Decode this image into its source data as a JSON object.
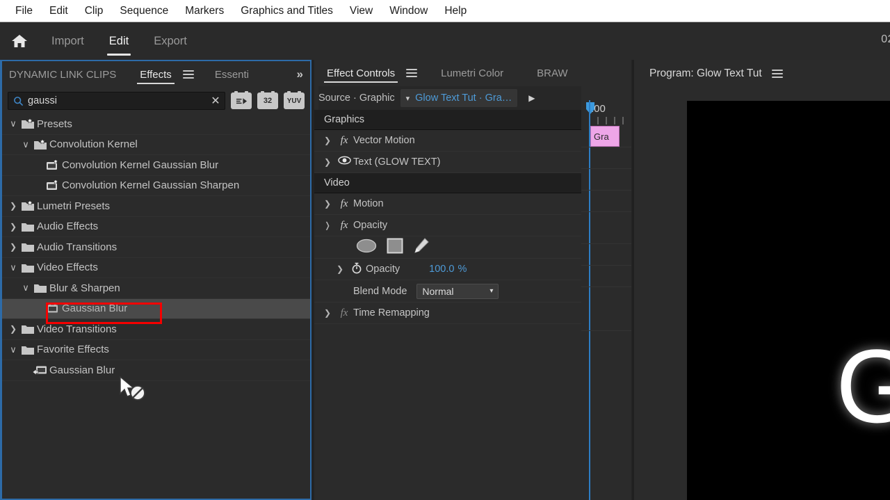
{
  "menubar": {
    "items": [
      "File",
      "Edit",
      "Clip",
      "Sequence",
      "Markers",
      "Graphics and Titles",
      "View",
      "Window",
      "Help"
    ]
  },
  "workspace": {
    "home_icon": "home-icon",
    "tabs": [
      {
        "label": "Import",
        "active": false
      },
      {
        "label": "Edit",
        "active": true
      },
      {
        "label": "Export",
        "active": false
      }
    ],
    "timecode": "02"
  },
  "effects_panel": {
    "tabs": [
      {
        "label": "DYNAMIC LINK CLIPS",
        "active": false
      },
      {
        "label": "Effects",
        "active": true
      },
      {
        "label": "Essenti",
        "active": false
      }
    ],
    "menu_icon": "hamburger-icon",
    "overflow_icon": "chevron-double-right-icon",
    "search": {
      "value": "gaussi",
      "placeholder": "",
      "icon": "search-icon",
      "clear_icon": "close-icon"
    },
    "filters": [
      {
        "label": "",
        "name": "accelerated-effects-filter"
      },
      {
        "label": "32",
        "name": "32-bit-color-filter"
      },
      {
        "label": "YUV",
        "name": "yuv-filter"
      }
    ],
    "tree": [
      {
        "label": "Presets",
        "indent": 0,
        "twist": "open",
        "icon": "folder-preset-icon",
        "selected": false
      },
      {
        "label": "Convolution Kernel",
        "indent": 1,
        "twist": "open",
        "icon": "folder-preset-icon",
        "selected": false
      },
      {
        "label": "Convolution Kernel Gaussian Blur",
        "indent": 2,
        "twist": "none",
        "icon": "preset-icon",
        "selected": false
      },
      {
        "label": "Convolution Kernel Gaussian Sharpen",
        "indent": 2,
        "twist": "none",
        "icon": "preset-icon",
        "selected": false
      },
      {
        "label": "Lumetri Presets",
        "indent": 0,
        "twist": "closed",
        "icon": "folder-preset-icon",
        "selected": false
      },
      {
        "label": "Audio Effects",
        "indent": 0,
        "twist": "closed",
        "icon": "folder-icon",
        "selected": false
      },
      {
        "label": "Audio Transitions",
        "indent": 0,
        "twist": "closed",
        "icon": "folder-icon",
        "selected": false
      },
      {
        "label": "Video Effects",
        "indent": 0,
        "twist": "open",
        "icon": "folder-icon",
        "selected": false
      },
      {
        "label": "Blur & Sharpen",
        "indent": 1,
        "twist": "open",
        "icon": "folder-icon",
        "selected": false
      },
      {
        "label": "Gaussian Blur",
        "indent": 2,
        "twist": "none",
        "icon": "effect-icon",
        "selected": true
      },
      {
        "label": "Video Transitions",
        "indent": 0,
        "twist": "closed",
        "icon": "folder-icon",
        "selected": false
      },
      {
        "label": "Favorite Effects",
        "indent": 0,
        "twist": "open",
        "icon": "folder-icon",
        "selected": false
      },
      {
        "label": "Gaussian Blur",
        "indent": 1,
        "twist": "none",
        "icon": "favorite-effect-icon",
        "selected": false
      }
    ],
    "annotation_color": "#f50000",
    "cursor_icon": "drag-no-drop-cursor"
  },
  "effect_controls": {
    "tabs": [
      {
        "label": "Effect Controls",
        "active": true
      },
      {
        "label": "Lumetri Color",
        "active": false
      },
      {
        "label": "BRAW",
        "active": false
      }
    ],
    "menu_icon": "hamburger-icon",
    "overflow_icon": "chevron-double-right-icon",
    "source_label": "Source · Graphic",
    "source_dropdown_icon": "chevron-down-icon",
    "clip_name": "Glow Text Tut  · Gra…",
    "play_icon": "play-triangle-icon",
    "sections": [
      {
        "title": "Graphics",
        "collapse_icon": "triangle-up-icon",
        "rows": [
          {
            "label": "Vector Motion",
            "icon": "fx-icon",
            "twist": "closed",
            "reset": true
          },
          {
            "label": "Text (GLOW TEXT)",
            "icon": "eye-icon",
            "twist": "closed",
            "reset": true
          }
        ]
      },
      {
        "title": "Video",
        "collapse_icon": "triangle-up-icon",
        "rows": [
          {
            "label": "Motion",
            "icon": "fx-icon",
            "twist": "closed",
            "reset": true
          },
          {
            "label": "Opacity",
            "icon": "fx-icon",
            "twist": "open",
            "reset": true
          }
        ]
      }
    ],
    "mask_tools": [
      "ellipse-mask-icon",
      "rectangle-mask-icon",
      "pen-mask-icon"
    ],
    "opacity": {
      "stopwatch_icon": "stopwatch-icon",
      "twist": "closed",
      "label": "Opacity",
      "value": "100.0",
      "unit": "%"
    },
    "blend_mode": {
      "label": "Blend Mode",
      "value": "Normal",
      "dropdown_icon": "chevron-down-icon"
    },
    "time_remapping": {
      "label": "Time Remapping",
      "icon": "fx-icon",
      "twist": "closed"
    },
    "timeline": {
      "time_label": ":00",
      "playhead_icon": "playhead-marker",
      "clip_label": "Gra",
      "clip_color": "#eea6e8"
    }
  },
  "program_monitor": {
    "title": "Program: Glow Text Tut",
    "menu_icon": "hamburger-icon",
    "stage_text": "G",
    "stage_bg": "#000000"
  }
}
